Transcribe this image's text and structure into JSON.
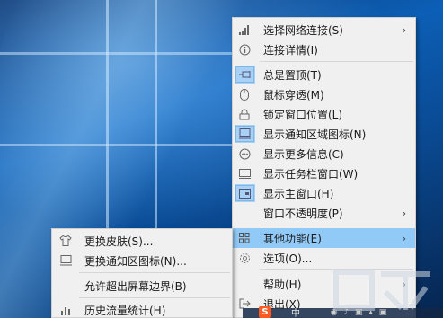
{
  "main_menu": {
    "items": [
      {
        "label": "选择网络连接(S)",
        "has_submenu": true
      },
      {
        "label": "连接详情(I)"
      },
      {
        "label": "总是置顶(T)",
        "checked": true
      },
      {
        "label": "鼠标穿透(M)"
      },
      {
        "label": "锁定窗口位置(L)"
      },
      {
        "label": "显示通知区域图标(N)",
        "checked": true
      },
      {
        "label": "显示更多信息(C)"
      },
      {
        "label": "显示任务栏窗口(W)"
      },
      {
        "label": "显示主窗口(H)",
        "checked": true
      },
      {
        "label": "窗口不透明度(P)",
        "has_submenu": true
      },
      {
        "label": "其他功能(E)",
        "has_submenu": true,
        "highlighted": true
      },
      {
        "label": "选项(O)..."
      },
      {
        "label": "帮助(H)",
        "has_submenu": true
      },
      {
        "label": "退出(X)"
      }
    ]
  },
  "sub_menu": {
    "items": [
      {
        "label": "更换皮肤(S)..."
      },
      {
        "label": "更换通知区图标(N)..."
      },
      {
        "label": "允许超出屏幕边界(B)"
      },
      {
        "label": "历史流量统计(H)"
      }
    ]
  },
  "taskbar": {
    "tray_s": "S",
    "tray_lang": "中",
    "tray_more": "◉ ♪ ▣ ▴ ▣"
  },
  "colors": {
    "highlight": "#91c9f7",
    "menu_bg": "#f0f0f0",
    "checked_bg": "#a8d2f5"
  },
  "icons": [
    "signal-icon",
    "info-icon",
    "pin-icon",
    "mouse-icon",
    "lock-icon",
    "tray-icon",
    "more-icon",
    "taskbar-window-icon",
    "main-window-icon",
    "grid-icon",
    "gear-icon",
    "exit-icon",
    "shirt-icon",
    "tray-icon",
    "chart-icon"
  ]
}
